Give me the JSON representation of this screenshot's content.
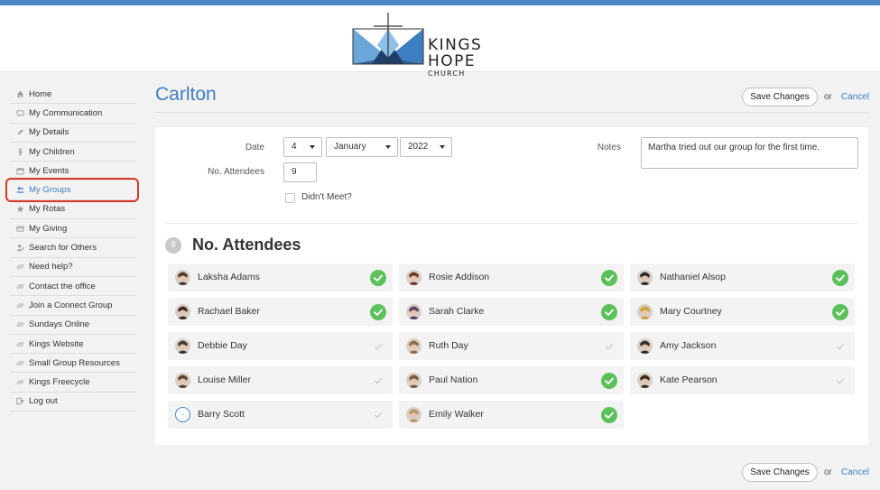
{
  "brand": {
    "name": "KINGS HOPE",
    "sub": "CHURCH"
  },
  "sidebar": {
    "items": [
      {
        "label": "Home",
        "icon": "home-icon"
      },
      {
        "label": "My Communication",
        "icon": "message-icon"
      },
      {
        "label": "My Details",
        "icon": "pencil-icon"
      },
      {
        "label": "My Children",
        "icon": "child-icon"
      },
      {
        "label": "My Events",
        "icon": "calendar-icon"
      },
      {
        "label": "My Groups",
        "icon": "users-icon",
        "active": true
      },
      {
        "label": "My Rotas",
        "icon": "star-icon"
      },
      {
        "label": "My Giving",
        "icon": "card-icon"
      },
      {
        "label": "Search for Others",
        "icon": "user-search-icon"
      },
      {
        "label": "Need help?",
        "icon": "link-icon"
      },
      {
        "label": "Contact the office",
        "icon": "link-icon"
      },
      {
        "label": "Join a Connect Group",
        "icon": "link-icon"
      },
      {
        "label": "Sundays Online",
        "icon": "link-icon"
      },
      {
        "label": "Kings Website",
        "icon": "link-icon"
      },
      {
        "label": "Small Group Resources",
        "icon": "link-icon"
      },
      {
        "label": "Kings Freecycle",
        "icon": "link-icon"
      },
      {
        "label": "Log out",
        "icon": "logout-icon"
      }
    ]
  },
  "page": {
    "title": "Carlton",
    "save_label": "Save Changes",
    "or_text": "or",
    "cancel_label": "Cancel"
  },
  "form": {
    "date_label": "Date",
    "day": "4",
    "month": "January",
    "year": "2022",
    "attendees_label": "No. Attendees",
    "attendees_value": "9",
    "didnt_meet_label": "Didn't Meet?",
    "notes_label": "Notes",
    "notes_value": "Martha tried out our group for the first time."
  },
  "attendance": {
    "count": "8",
    "title": "No. Attendees",
    "people": [
      {
        "name": "Laksha Adams",
        "present": true
      },
      {
        "name": "Rosie Addison",
        "present": true
      },
      {
        "name": "Nathaniel Alsop",
        "present": true
      },
      {
        "name": "Rachael Baker",
        "present": true
      },
      {
        "name": "Sarah Clarke",
        "present": true
      },
      {
        "name": "Mary Courtney",
        "present": true
      },
      {
        "name": "Debbie Day",
        "present": false
      },
      {
        "name": "Ruth Day",
        "present": false
      },
      {
        "name": "Amy Jackson",
        "present": false
      },
      {
        "name": "Louise Miller",
        "present": false
      },
      {
        "name": "Paul Nation",
        "present": true
      },
      {
        "name": "Kate Pearson",
        "present": false
      },
      {
        "name": "Barry Scott",
        "present": false,
        "no_photo": true
      },
      {
        "name": "Emily Walker",
        "present": true
      }
    ]
  },
  "colors": {
    "accent": "#3e7fc2",
    "present": "#5cc15a",
    "highlight": "#d8372a"
  }
}
